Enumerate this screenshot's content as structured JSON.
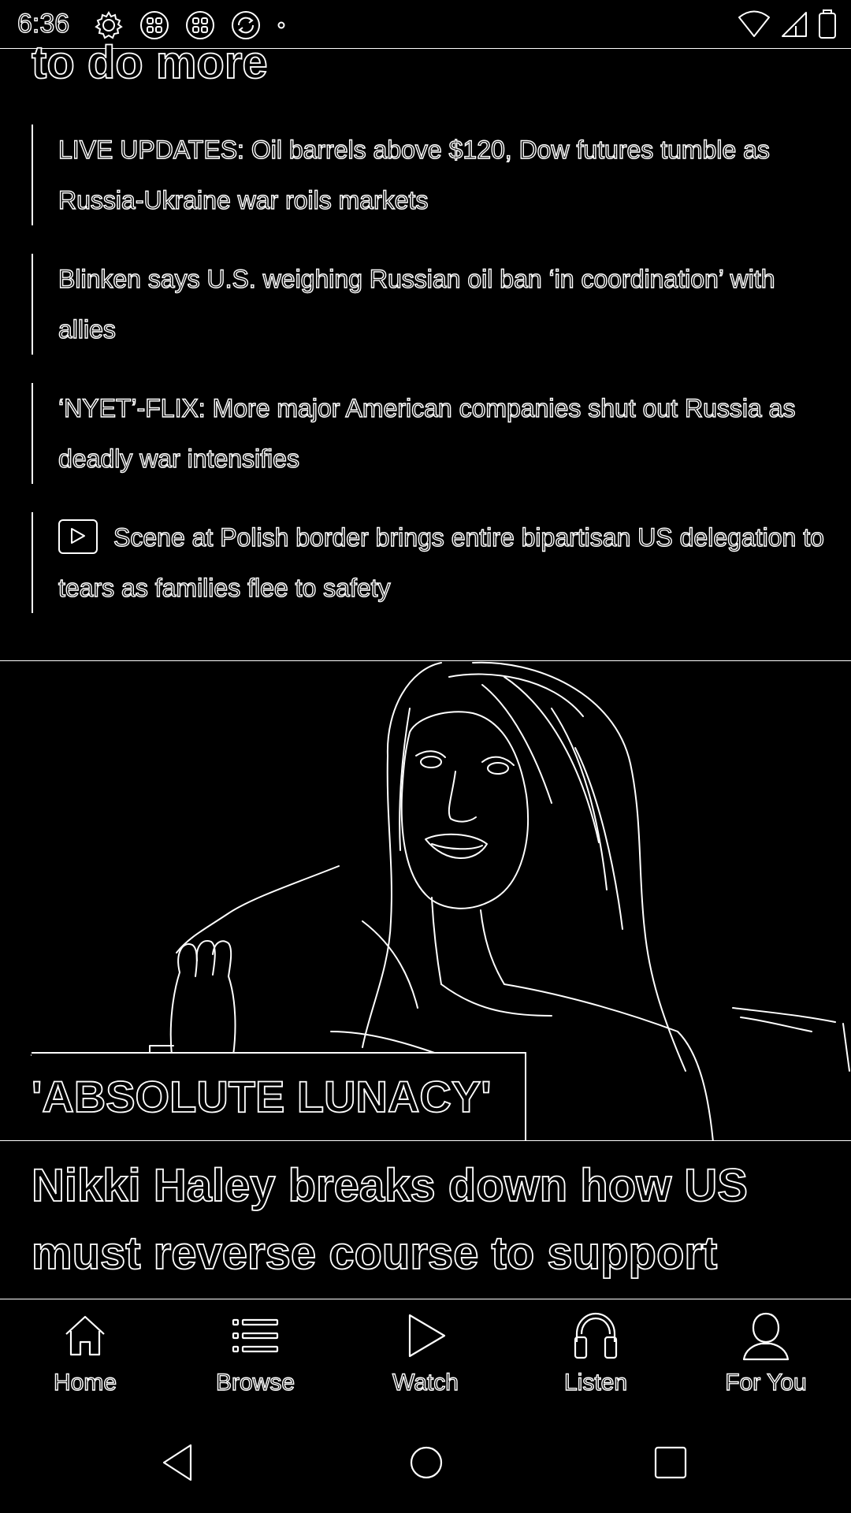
{
  "status_bar": {
    "time": "6:36",
    "left_icons": [
      "settings-icon",
      "app-grid-icon",
      "app-grid-icon",
      "sync-icon",
      "dot-icon"
    ],
    "right_icons": [
      "wifi-icon",
      "signal-icon",
      "battery-icon"
    ]
  },
  "article": {
    "cut_headline": "to do more",
    "related": [
      {
        "text": "LIVE UPDATES: Oil barrels above $120, Dow futures tumble as Russia-Ukraine war roils markets",
        "video": false
      },
      {
        "text": "Blinken says U.S. weighing Russian oil ban ‘in coordination’ with allies",
        "video": false
      },
      {
        "text": "‘NYET’-FLIX: More major American companies shut out Russia as deadly war intensifies",
        "video": false
      },
      {
        "text": "Scene at Polish border brings entire bipartisan US delegation to tears as families flee to safety",
        "video": true
      }
    ]
  },
  "hero": {
    "tag": "'ABSOLUTE LUNACY'",
    "title": "Nikki Haley breaks down how US must reverse course to support"
  },
  "bottom_nav": {
    "items": [
      {
        "label": "Home",
        "icon": "home-icon"
      },
      {
        "label": "Browse",
        "icon": "list-icon"
      },
      {
        "label": "Watch",
        "icon": "play-icon"
      },
      {
        "label": "Listen",
        "icon": "headphones-icon"
      },
      {
        "label": "For You",
        "icon": "person-icon"
      }
    ]
  },
  "system_nav": {
    "buttons": [
      "back-icon",
      "home-circle-icon",
      "recents-icon"
    ]
  }
}
